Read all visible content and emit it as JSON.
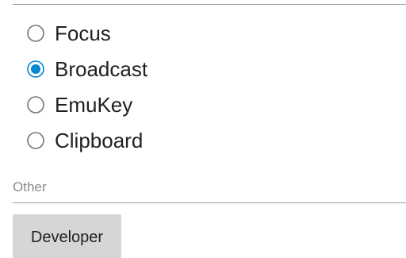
{
  "colors": {
    "accent": "#0288d1",
    "radio_unchecked": "#757575",
    "divider": "#9e9e9e",
    "section_header": "#8a8a8a",
    "button_bg": "#d6d6d6"
  },
  "radio_options": [
    {
      "label": "Focus",
      "checked": false
    },
    {
      "label": "Broadcast",
      "checked": true
    },
    {
      "label": "EmuKey",
      "checked": false
    },
    {
      "label": "Clipboard",
      "checked": false
    }
  ],
  "other_section": {
    "header": "Other",
    "developer_button_label": "Developer"
  }
}
